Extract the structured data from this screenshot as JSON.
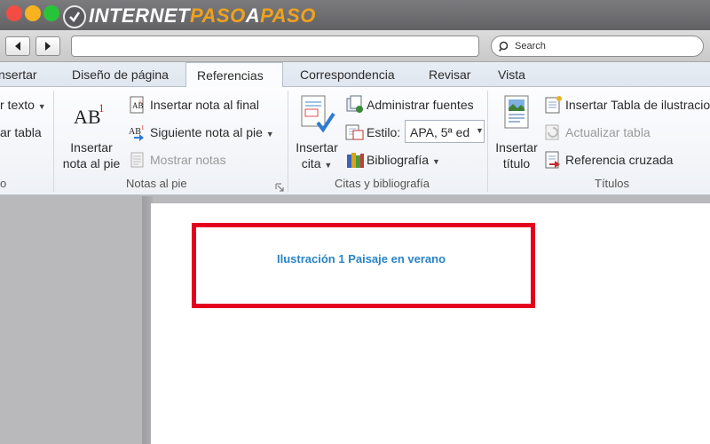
{
  "brand": {
    "prefix": "INTERNET",
    "highlight": "PASO",
    "a": "A",
    "suffix": "PASO"
  },
  "browser": {
    "search_placeholder": "Search"
  },
  "tabs": [
    "nsertar",
    "Diseño de página",
    "Referencias",
    "Correspondencia",
    "Revisar",
    "Vista"
  ],
  "ribbon": {
    "toc_group": {
      "insert_text": "r texto",
      "update_table": "ar tabla",
      "label": "o"
    },
    "footnotes": {
      "insert_footnote_line1": "Insertar",
      "insert_footnote_line2": "nota al pie",
      "insert_endnote": "Insertar nota al final",
      "next_footnote": "Siguiente nota al pie",
      "show_notes": "Mostrar notas",
      "label": "Notas al pie"
    },
    "citations": {
      "insert_citation_line1": "Insertar",
      "insert_citation_line2": "cita",
      "manage_sources": "Administrar fuentes",
      "style_label": "Estilo:",
      "style_value": "APA, 5ª ed",
      "bibliography": "Bibliografía",
      "label": "Citas y bibliografía"
    },
    "captions": {
      "insert_caption_line1": "Insertar",
      "insert_caption_line2": "título",
      "insert_table_of_figures": "Insertar Tabla de ilustracio",
      "update_table": "Actualizar tabla",
      "cross_reference": "Referencia cruzada",
      "label": "Títulos"
    }
  },
  "document": {
    "caption": "Ilustración 1 Paisaje en verano"
  },
  "colors": {
    "highlight_box": "#e4001f",
    "caption_text": "#2a83c4",
    "brand_accent": "#f0a21c"
  }
}
